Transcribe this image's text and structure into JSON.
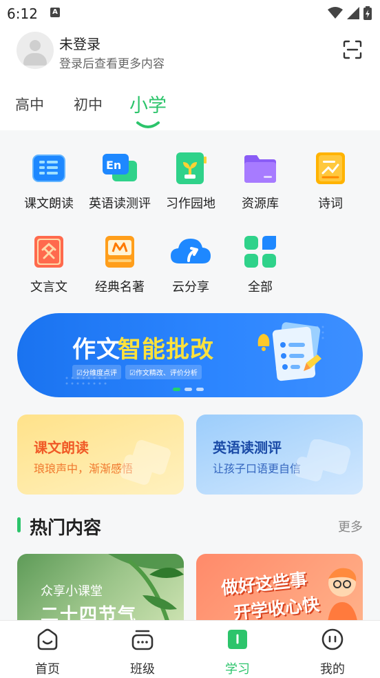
{
  "status_bar": {
    "time": "6:12",
    "badge": "A"
  },
  "user": {
    "name": "未登录",
    "subtitle": "登录后查看更多内容"
  },
  "grade_tabs": [
    {
      "label": "高中",
      "active": false
    },
    {
      "label": "初中",
      "active": false
    },
    {
      "label": "小学",
      "active": true
    }
  ],
  "features": [
    {
      "label": "课文朗读",
      "icon": "textbook-reading-icon"
    },
    {
      "label": "英语读测评",
      "icon": "english-eval-icon"
    },
    {
      "label": "习作园地",
      "icon": "writing-garden-icon"
    },
    {
      "label": "资源库",
      "icon": "folder-icon"
    },
    {
      "label": "诗词",
      "icon": "poetry-icon"
    },
    {
      "label": "文言文",
      "icon": "classical-chinese-icon"
    },
    {
      "label": "经典名著",
      "icon": "classic-books-icon"
    },
    {
      "label": "云分享",
      "icon": "cloud-share-icon"
    },
    {
      "label": "全部",
      "icon": "all-apps-icon"
    }
  ],
  "banner": {
    "title_white": "作文",
    "title_yellow": "智能批改",
    "tags": [
      "☑分维度点评",
      "☑作文精改、评价分析"
    ]
  },
  "cards": [
    {
      "title": "课文朗读",
      "subtitle": "琅琅声中，渐渐感悟"
    },
    {
      "title": "英语读测评",
      "subtitle": "让孩子口语更自信"
    }
  ],
  "hot": {
    "title": "热门内容",
    "more": "更多",
    "items": [
      {
        "subtitle": "众享小课堂",
        "title": "二十四节气"
      },
      {
        "line1": "做好这些事",
        "line2": "开学收心快"
      }
    ]
  },
  "bottom_nav": [
    {
      "label": "首页",
      "active": false
    },
    {
      "label": "班级",
      "active": false
    },
    {
      "label": "学习",
      "active": true
    },
    {
      "label": "我的",
      "active": false
    }
  ],
  "colors": {
    "accent": "#2cc46b",
    "banner_blue": "#1a73f0",
    "banner_yellow": "#ffe23b"
  }
}
